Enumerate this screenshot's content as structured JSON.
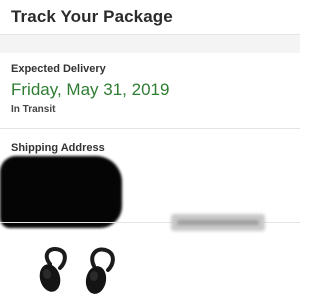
{
  "header": {
    "title": "Track Your Package"
  },
  "delivery": {
    "heading": "Expected Delivery",
    "date": "Friday, May 31, 2019",
    "status": "In Transit"
  },
  "shipping": {
    "heading": "Shipping Address"
  },
  "colors": {
    "accent_green": "#2e7d32",
    "text_dark": "#2b2b2b",
    "band_gray": "#f4f4f4"
  },
  "icons": {
    "product": "wireless-earbuds-icon"
  }
}
